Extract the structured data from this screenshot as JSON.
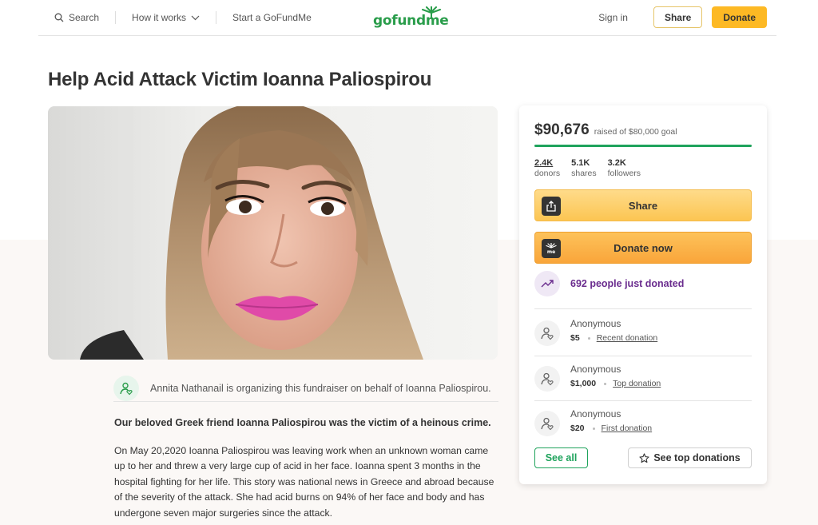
{
  "header": {
    "search_label": "Search",
    "how_it_works_label": "How it works",
    "start_label": "Start a GoFundMe",
    "logo_text": "gofundme",
    "signin_label": "Sign in",
    "share_label": "Share",
    "donate_label": "Donate"
  },
  "campaign": {
    "title": "Help Acid Attack Victim Ioanna Paliospirou",
    "organizer_text": "Annita Nathanail is organizing this fundraiser on behalf of Ioanna Paliospirou.",
    "story_lead": "Our beloved Greek friend Ioanna Paliospirou was the victim of a heinous crime.",
    "story_body": "On May 20,2020 Ioanna Paliospirou was leaving work when an unknown woman came up to her and threw a very large cup of acid in her face. Ioanna spent 3 months in the hospital fighting for her life. This story was national news in Greece and abroad because of the severity of the attack. She had acid burns on 94% of her face and body and has undergone seven major surgeries since the attack."
  },
  "card": {
    "raised_amount": "$90,676",
    "goal_text": "raised of $80,000 goal",
    "progress_fraction": 1.0,
    "stats": [
      {
        "value": "2.4K",
        "label": "donors"
      },
      {
        "value": "5.1K",
        "label": "shares"
      },
      {
        "value": "3.2K",
        "label": "followers"
      }
    ],
    "share_label": "Share",
    "donate_label": "Donate now",
    "recent_text": "692 people just donated",
    "donations": [
      {
        "name": "Anonymous",
        "amount": "$5",
        "tag": "Recent donation"
      },
      {
        "name": "Anonymous",
        "amount": "$1,000",
        "tag": "Top donation"
      },
      {
        "name": "Anonymous",
        "amount": "$20",
        "tag": "First donation"
      }
    ],
    "see_all_label": "See all",
    "see_top_label": "See top donations"
  },
  "colors": {
    "brand_green": "#2a9d4b",
    "donate_yellow": "#fdb924",
    "recent_purple": "#6a2c8e",
    "progress_green": "#1fa35c"
  }
}
